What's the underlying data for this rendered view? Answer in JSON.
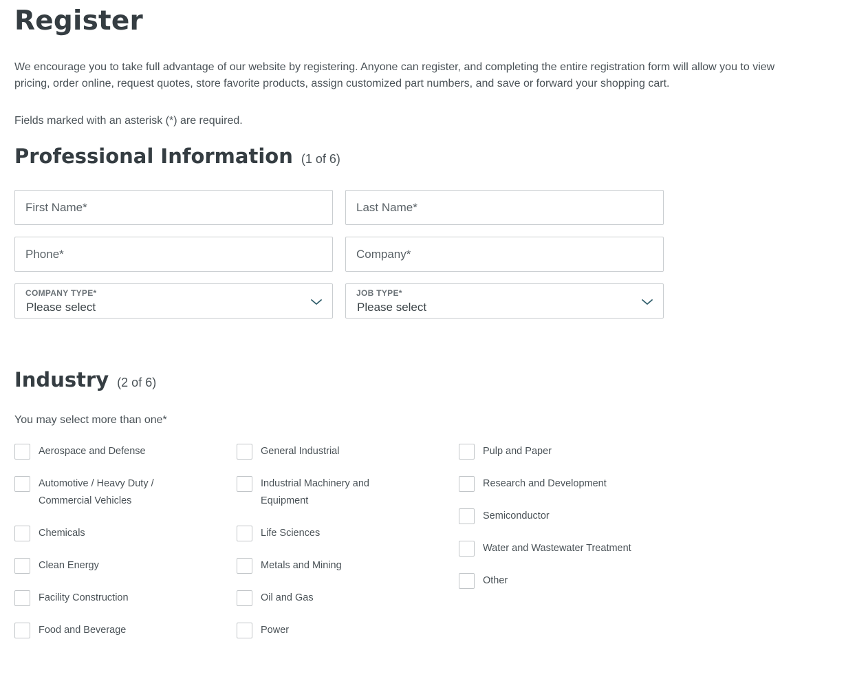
{
  "header": {
    "title": "Register",
    "intro": "We encourage you to take full advantage of our website by registering. Anyone can register, and completing the entire registration form will allow you to view pricing, order online, request quotes, store favorite products, assign customized part numbers, and save or forward your shopping cart.",
    "required_note": "Fields marked with an asterisk (*) are required."
  },
  "professional": {
    "title": "Professional Information",
    "step": "(1 of 6)",
    "first_name": {
      "placeholder": "First Name*",
      "value": ""
    },
    "last_name": {
      "placeholder": "Last Name*",
      "value": ""
    },
    "phone": {
      "placeholder": "Phone*",
      "value": ""
    },
    "company": {
      "placeholder": "Company*",
      "value": ""
    },
    "company_type": {
      "label": "COMPANY TYPE*",
      "value": "Please select"
    },
    "job_type": {
      "label": "JOB TYPE*",
      "value": "Please select"
    }
  },
  "industry": {
    "title": "Industry",
    "step": "(2 of 6)",
    "hint": "You may select more than one*",
    "columns": [
      [
        "Aerospace and Defense",
        "Automotive / Heavy Duty / Commercial Vehicles",
        "Chemicals",
        "Clean Energy",
        "Facility Construction",
        "Food and Beverage"
      ],
      [
        "General Industrial",
        "Industrial Machinery and Equipment",
        "Life Sciences",
        "Metals and Mining",
        "Oil and Gas",
        "Power"
      ],
      [
        "Pulp and Paper",
        "Research and Development",
        "Semiconductor",
        "Water and Wastewater Treatment",
        "Other"
      ]
    ]
  },
  "icons": {
    "select_chevron": "chevron-down-icon"
  },
  "colors": {
    "text": "#3c4448",
    "heading": "#353d42",
    "border": "#c9cdd0",
    "chevron": "#2f5d6b"
  }
}
